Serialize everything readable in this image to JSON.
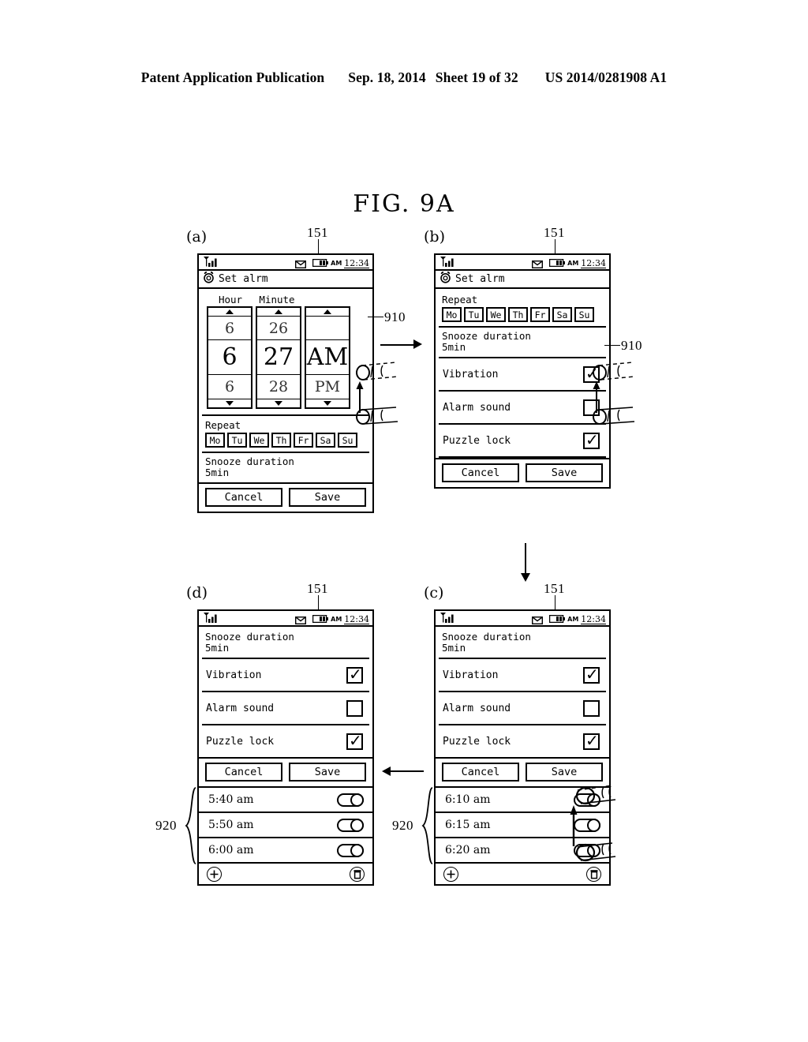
{
  "publication": {
    "left": "Patent Application Publication",
    "date": "Sep. 18, 2014",
    "sheet": "Sheet 19 of 32",
    "number": "US 2014/0281908 A1"
  },
  "figure": {
    "title": "FIG.  9A"
  },
  "refs": {
    "display_151": "151",
    "gesture_910": "910",
    "list_920": "920"
  },
  "status_bar": {
    "time": "12:34",
    "ampm": "AM",
    "signal_icon": "signal-bars-icon",
    "message_icon": "envelope-icon",
    "battery_icon": "battery-icon"
  },
  "title_bar": {
    "icon": "alarm-clock-icon",
    "label": "Set alrm"
  },
  "panels": {
    "a": {
      "letter": "(a)",
      "picker": {
        "hour_label": "Hour",
        "minute_label": "Minute",
        "hour": [
          "6",
          "6",
          "6"
        ],
        "minute": [
          "26",
          "27",
          "28"
        ],
        "meridiem": [
          "",
          "AM",
          "PM"
        ],
        "up_arrow": "triangle-up-icon",
        "down_arrow": "triangle-down-icon"
      },
      "repeat": {
        "label": "Repeat",
        "days": [
          "Mo",
          "Tu",
          "We",
          "Th",
          "Fr",
          "Sa",
          "Su"
        ]
      },
      "snooze": {
        "label": "Snooze duration",
        "value": "5min"
      },
      "buttons": {
        "cancel": "Cancel",
        "save": "Save"
      }
    },
    "b": {
      "letter": "(b)",
      "repeat": {
        "label": "Repeat",
        "days": [
          "Mo",
          "Tu",
          "We",
          "Th",
          "Fr",
          "Sa",
          "Su"
        ]
      },
      "snooze": {
        "label": "Snooze duration",
        "value": "5min"
      },
      "settings": [
        {
          "label": "Vibration",
          "checked": true
        },
        {
          "label": "Alarm sound",
          "checked": false
        },
        {
          "label": "Puzzle lock",
          "checked": true
        }
      ],
      "buttons": {
        "cancel": "Cancel",
        "save": "Save"
      }
    },
    "c": {
      "letter": "(c)",
      "snooze": {
        "label": "Snooze duration",
        "value": "5min"
      },
      "settings": [
        {
          "label": "Vibration",
          "checked": true
        },
        {
          "label": "Alarm sound",
          "checked": false
        },
        {
          "label": "Puzzle lock",
          "checked": true
        }
      ],
      "buttons": {
        "cancel": "Cancel",
        "save": "Save"
      },
      "alarms": [
        {
          "time": "6:10  am",
          "on": true
        },
        {
          "time": "6:15  am",
          "on": true
        },
        {
          "time": "6:20  am",
          "on": true
        }
      ],
      "list_bar": {
        "add_icon": "plus-circle-icon",
        "delete_icon": "trash-circle-icon"
      }
    },
    "d": {
      "letter": "(d)",
      "snooze": {
        "label": "Snooze duration",
        "value": "5min"
      },
      "settings": [
        {
          "label": "Vibration",
          "checked": true
        },
        {
          "label": "Alarm sound",
          "checked": false
        },
        {
          "label": "Puzzle lock",
          "checked": true
        }
      ],
      "buttons": {
        "cancel": "Cancel",
        "save": "Save"
      },
      "alarms": [
        {
          "time": "5:40  am",
          "on": true
        },
        {
          "time": "5:50  am",
          "on": true
        },
        {
          "time": "6:00  am",
          "on": true
        }
      ],
      "list_bar": {
        "add_icon": "plus-circle-icon",
        "delete_icon": "trash-circle-icon"
      }
    }
  },
  "check_glyph": "✓"
}
